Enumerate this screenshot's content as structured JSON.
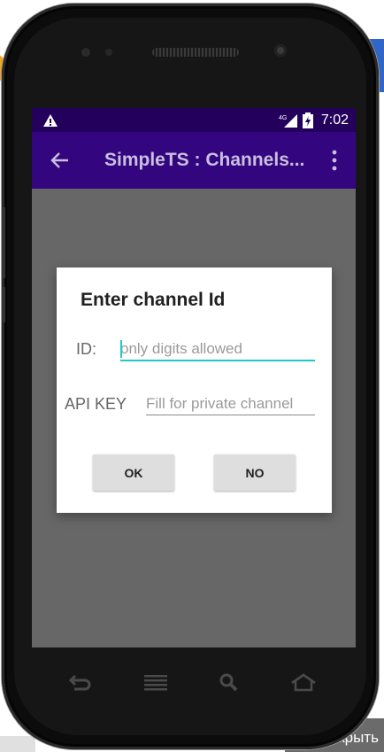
{
  "status_bar": {
    "time": "7:02",
    "network_label": "4G",
    "icons": [
      "warning-icon",
      "signal-4g-icon",
      "battery-icon"
    ]
  },
  "toolbar": {
    "title": "SimpleTS : Channels...",
    "back_icon": "arrow-back-icon",
    "menu_icon": "more-vert-icon"
  },
  "dialog": {
    "title": "Enter channel Id",
    "id_label": "ID:",
    "id_placeholder": "only digits allowed",
    "api_key_label": "API KEY",
    "api_key_placeholder": "Fill for private channel",
    "ok_button": "OK",
    "no_button": "NO"
  },
  "navbar": {
    "icons": [
      "back-nav-icon",
      "menu-nav-icon",
      "search-nav-icon",
      "home-nav-icon"
    ]
  },
  "background": {
    "close_label": "Закрыть"
  },
  "colors": {
    "status_bar": "#23005c",
    "toolbar": "#33057e",
    "accent": "#1ec8c8",
    "scrim": "#676767"
  }
}
